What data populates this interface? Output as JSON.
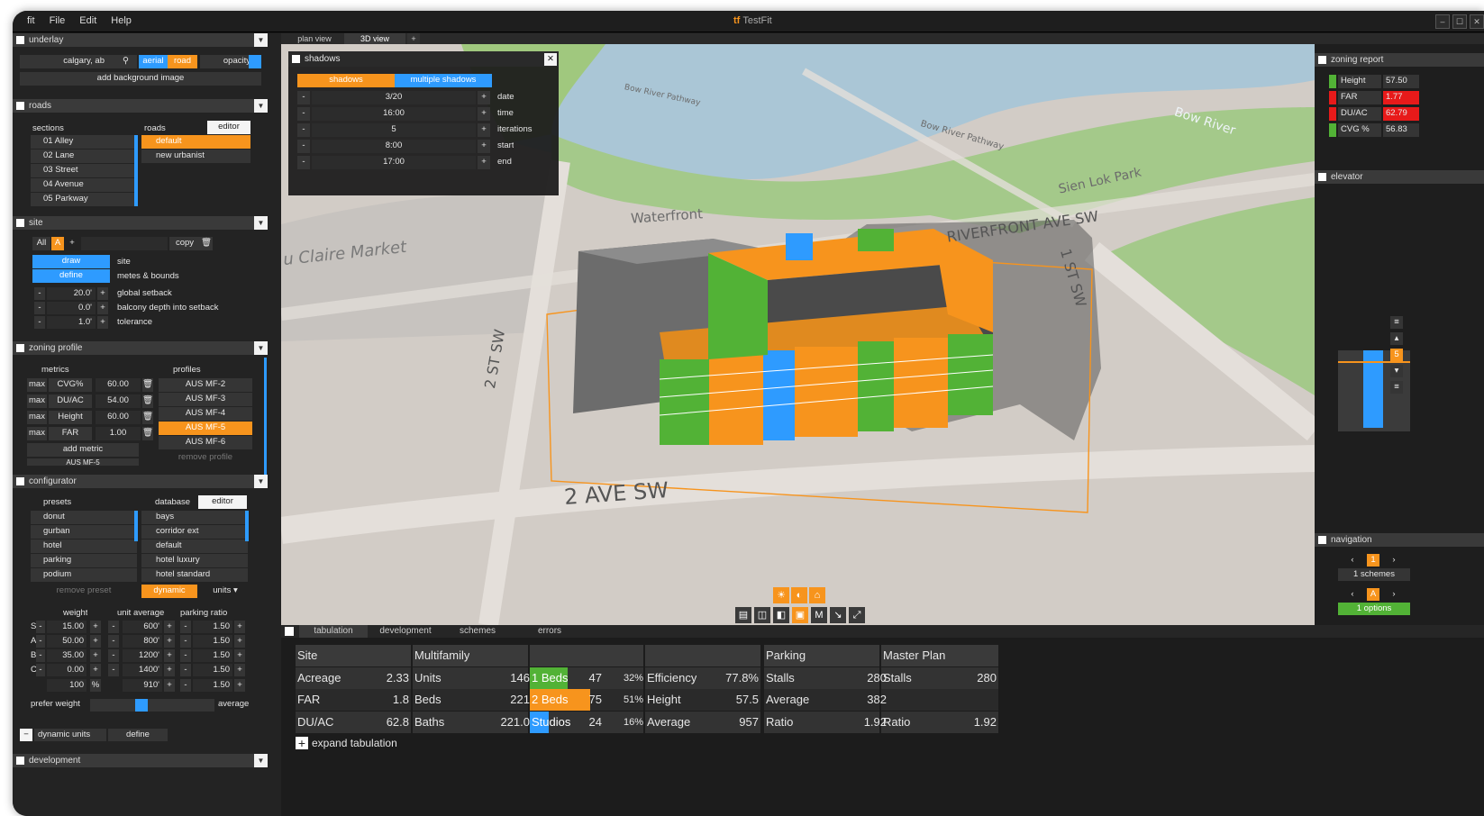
{
  "app": {
    "title": "TestFit",
    "menu": [
      "File",
      "Edit",
      "Help"
    ],
    "menu_cut": "fit"
  },
  "underlay": {
    "title": "underlay",
    "location": "calgary, ab",
    "aerial": "aerial",
    "road": "road",
    "opacity": "opacity",
    "add_bg": "add background image"
  },
  "roads": {
    "title": "roads",
    "sections_label": "sections",
    "roads_label": "roads",
    "editor": "editor",
    "sections": [
      "01 Alley",
      "02 Lane",
      "03 Street",
      "04 Avenue",
      "05 Parkway"
    ],
    "road_types": [
      "default",
      "new urbanist"
    ]
  },
  "site": {
    "title": "site",
    "all": "All",
    "a": "A",
    "plus": "+",
    "copy": "copy",
    "draw": "draw",
    "define": "define",
    "site_label": "site",
    "metes": "metes & bounds",
    "rows": [
      {
        "value": "20.0'",
        "label": "global setback"
      },
      {
        "value": "0.0'",
        "label": "balcony depth into setback"
      },
      {
        "value": "1.0'",
        "label": "tolerance"
      }
    ]
  },
  "zoning": {
    "title": "zoning profile",
    "metrics_label": "metrics",
    "profiles_label": "profiles",
    "metrics": [
      {
        "mode": "max",
        "name": "CVG%",
        "value": "60.00"
      },
      {
        "mode": "max",
        "name": "DU/AC",
        "value": "54.00"
      },
      {
        "mode": "max",
        "name": "Height",
        "value": "60.00"
      },
      {
        "mode": "max",
        "name": "FAR",
        "value": "1.00"
      }
    ],
    "add_metric": "add metric",
    "profile_select": "AUS MF-5",
    "profiles": [
      "AUS MF-2",
      "AUS MF-3",
      "AUS MF-4",
      "AUS MF-5",
      "AUS MF-6"
    ],
    "remove_profile": "remove profile"
  },
  "configurator": {
    "title": "configurator",
    "presets_label": "presets",
    "database_label": "database",
    "editor": "editor",
    "presets": [
      "donut",
      "gurban",
      "hotel",
      "parking",
      "podium"
    ],
    "database": [
      "bays",
      "corridor ext",
      "default",
      "hotel luxury",
      "hotel standard"
    ],
    "remove_preset": "remove preset",
    "dynamic": "dynamic",
    "units": "units",
    "col_weight": "weight",
    "col_unit_avg": "unit average",
    "col_parking": "parking ratio",
    "rows": [
      {
        "k": "S",
        "w": "15.00",
        "u": "600'",
        "p": "1.50"
      },
      {
        "k": "A",
        "w": "50.00",
        "u": "800'",
        "p": "1.50"
      },
      {
        "k": "B",
        "w": "35.00",
        "u": "1200'",
        "p": "1.50"
      },
      {
        "k": "C",
        "w": "0.00",
        "u": "1400'",
        "p": "1.50"
      }
    ],
    "total": {
      "w": "100",
      "pct": "%",
      "u": "910'",
      "p": "1.50"
    },
    "prefer_weight": "prefer weight",
    "average": "average",
    "dynamic_units": "dynamic units",
    "define": "define",
    "development": "development"
  },
  "view_tabs": [
    "plan view",
    "3D view",
    "+"
  ],
  "shadows": {
    "title": "shadows",
    "tab1": "shadows",
    "tab2": "multiple shadows",
    "rows": [
      {
        "value": "3/20",
        "label": "date"
      },
      {
        "value": "16:00",
        "label": "time"
      },
      {
        "value": "5",
        "label": "iterations"
      },
      {
        "value": "8:00",
        "label": "start"
      },
      {
        "value": "17:00",
        "label": "end"
      }
    ]
  },
  "map_labels": {
    "bow1": "Bow River Pathway",
    "bow2": "Bow River Pathway",
    "bow_river": "Bow River",
    "sien": "Sien Lok Park",
    "waterfront": "Waterfront",
    "riverfront": "RIVERFRONT AVE SW",
    "first_st": "1 ST SW",
    "second_st": "2 ST SW",
    "second_ave": "2 AVE SW",
    "market": "u Claire Market"
  },
  "zoning_report": {
    "title": "zoning report",
    "rows": [
      {
        "label": "Height",
        "value": "57.50",
        "status": "#52b236"
      },
      {
        "label": "FAR",
        "value": "1.77",
        "status": "#e81a1a"
      },
      {
        "label": "DU/AC",
        "value": "62.79",
        "status": "#e81a1a"
      },
      {
        "label": "CVG %",
        "value": "56.83",
        "status": "#52b236"
      }
    ]
  },
  "elevator": {
    "title": "elevator",
    "floor": "5"
  },
  "navigation": {
    "title": "navigation",
    "scheme_num": "1",
    "schemes": "1 schemes",
    "option_letter": "A",
    "options": "1 options"
  },
  "bottom_tabs": [
    "tabulation",
    "development",
    "schemes",
    "errors"
  ],
  "tabulation": {
    "headers": {
      "site": "Site",
      "multifamily": "Multifamily",
      "parking": "Parking",
      "master_plan": "Master Plan"
    },
    "rows": [
      {
        "s_l": "Acreage",
        "s_v": "2.33",
        "m_l": "Units",
        "m_v": "146",
        "u_l": "1 Beds",
        "u_n": "47",
        "u_p": "32%",
        "e_l": "Efficiency",
        "e_v": "77.8%",
        "p_l": "Stalls",
        "p_v": "280",
        "mp_l": "Stalls",
        "mp_v": "280"
      },
      {
        "s_l": "FAR",
        "s_v": "1.8",
        "m_l": "Beds",
        "m_v": "221",
        "u_l": "2 Beds",
        "u_n": "75",
        "u_p": "51%",
        "e_l": "Height",
        "e_v": "57.5",
        "p_l": "Average",
        "p_v": "382",
        "mp_l": "",
        "mp_v": ""
      },
      {
        "s_l": "DU/AC",
        "s_v": "62.8",
        "m_l": "Baths",
        "m_v": "221.0",
        "u_l": "Studios",
        "u_n": "24",
        "u_p": "16%",
        "e_l": "Average",
        "e_v": "957",
        "p_l": "Ratio",
        "p_v": "1.92",
        "mp_l": "Ratio",
        "mp_v": "1.92"
      }
    ],
    "unit_mix_fill": [
      0.32,
      0.51,
      0.16
    ],
    "expand": "expand tabulation"
  },
  "colors": {
    "accent": "#f7941d",
    "blue": "#2e9bff",
    "green": "#52b236",
    "red": "#e81a1a"
  }
}
